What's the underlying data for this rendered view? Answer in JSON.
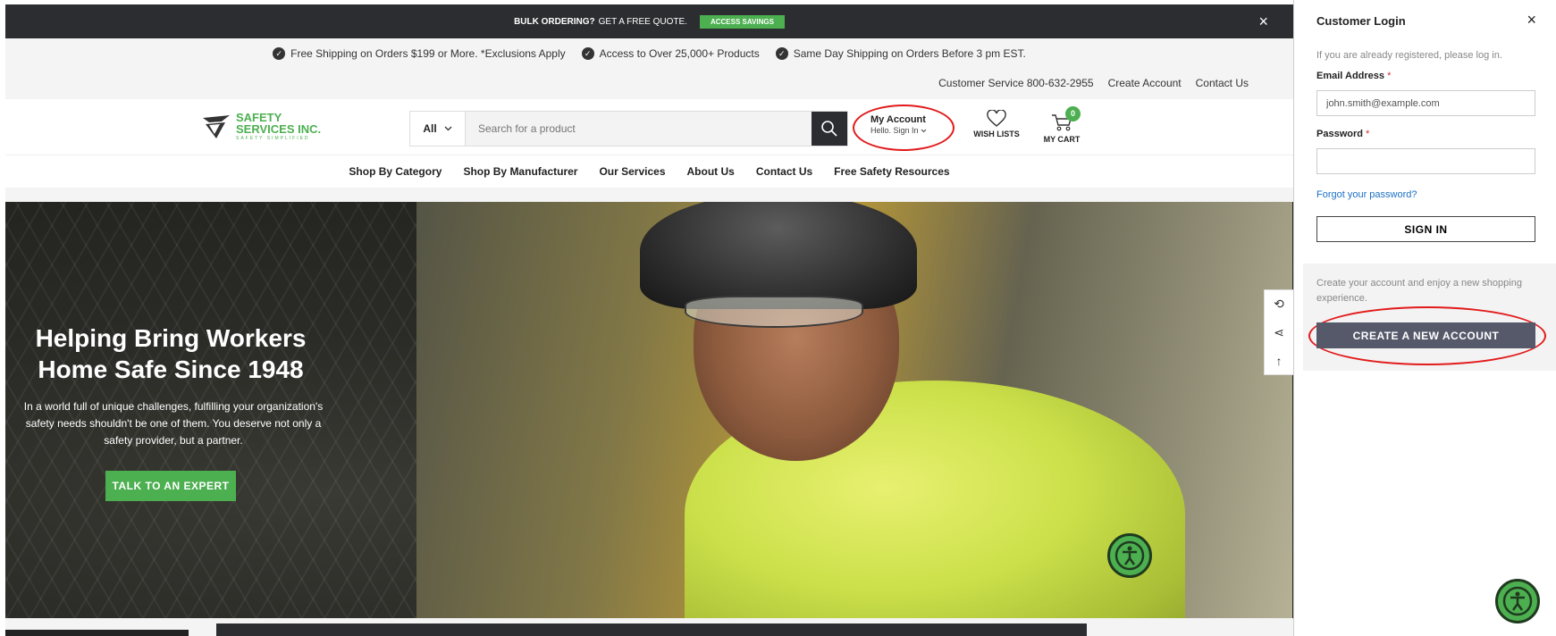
{
  "promo": {
    "bold": "BULK ORDERING?",
    "text": "GET A FREE QUOTE.",
    "button": "ACCESS SAVINGS",
    "close": "×"
  },
  "benefits": [
    "Free Shipping on Orders $199 or More. *Exclusions Apply",
    "Access to Over 25,000+ Products",
    "Same Day Shipping on Orders Before 3 pm EST."
  ],
  "util_links": {
    "customer_service": "Customer Service 800-632-2955",
    "create_account": "Create Account",
    "contact_us": "Contact Us"
  },
  "logo": {
    "line1": "SAFETY",
    "line2": "SERVICES INC.",
    "tagline": "SAFETY SIMPLIFIED"
  },
  "search": {
    "category": "All",
    "placeholder": "Search for a product"
  },
  "account": {
    "title": "My Account",
    "subtitle": "Hello. Sign In"
  },
  "wish_lists": "WISH LISTS",
  "cart": {
    "label": "MY CART",
    "count": "0"
  },
  "nav": [
    "Shop By Category",
    "Shop By Manufacturer",
    "Our Services",
    "About Us",
    "Contact Us",
    "Free Safety Resources"
  ],
  "hero": {
    "title_line1": "Helping Bring Workers",
    "title_line2": "Home Safe Since 1948",
    "text": "In a world full of unique challenges, fulfilling your organization's safety needs shouldn't be one of them. You deserve not only a safety provider, but a partner.",
    "cta": "TALK TO AN EXPERT"
  },
  "login_panel": {
    "title": "Customer Login",
    "close": "×",
    "note": "If you are already registered, please log in.",
    "email_label": "Email Address",
    "email_value": "john.smith@example.com",
    "password_label": "Password",
    "required_mark": "*",
    "forgot": "Forgot your password?",
    "sign_in": "SIGN IN",
    "create_note": "Create your account and enjoy a new shopping experience.",
    "create_button": "CREATE A NEW ACCOUNT"
  },
  "colors": {
    "brand_green": "#4caf50",
    "dark": "#2b2d30",
    "highlight_red": "#e21b1b"
  }
}
